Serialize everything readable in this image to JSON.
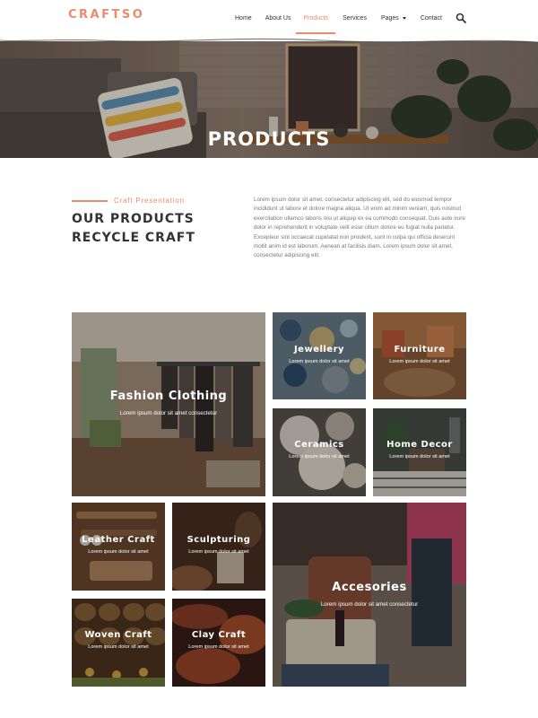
{
  "brand": {
    "logo": "CRAFTSO",
    "accent": "#ec8b6c"
  },
  "nav": {
    "items": [
      "Home",
      "About Us",
      "Products",
      "Services",
      "Pages",
      "Contact"
    ],
    "active": "Products",
    "search_icon": "search-icon",
    "pages_icon": "chevron-down-icon"
  },
  "hero": {
    "title": "PRODUCTS"
  },
  "intro": {
    "kicker": "Craft Presentation",
    "heading": "OUR PRODUCTS RECYCLE CRAFT",
    "body": "Lorem ipsum dolor sit amet, consectetur adipiscing elit, sed do eiusmod tempor incididunt ut labore et dolore magna aliqua. Ut enim ad minim veniam, quis nostrud exercitation ullamco laboris nisi ut aliquip ex ea commodo consequat. Duis aute irure dolor in reprehenderit in voluptate velit esse cillum dolore eu fugiat nulla pariatur. Excepteur sint occaecat cupidatat non proident, sunt in culpa qui officia deserunt mollit anim id est laborum. Aenean at facilisis diam. Lorem ipsum dolor sit amet, consectetur adipiscing elit."
  },
  "categories": [
    {
      "title": "Fashion Clothing",
      "subtitle": "Lorem ipsum dolor sit amet consectetur"
    },
    {
      "title": "Jewellery",
      "subtitle": "Lorem ipsum dolor sit amet"
    },
    {
      "title": "Furniture",
      "subtitle": "Lorem ipsum dolor sit amet"
    },
    {
      "title": "Ceramics",
      "subtitle": "Lorem ipsum dolor sit amet"
    },
    {
      "title": "Home Decor",
      "subtitle": "Lorem ipsum dolor sit amet"
    },
    {
      "title": "Leather Craft",
      "subtitle": "Lorem ipsum dolor sit amet"
    },
    {
      "title": "Sculpturing",
      "subtitle": "Lorem ipsum dolor sit amet"
    },
    {
      "title": "Accesories",
      "subtitle": "Lorem ipsum dolor sit amet consectetur"
    },
    {
      "title": "Woven Craft",
      "subtitle": "Lorem ipsum dolor sit amet"
    },
    {
      "title": "Clay Craft",
      "subtitle": "Lorem ipsum dolor sit amet"
    }
  ]
}
